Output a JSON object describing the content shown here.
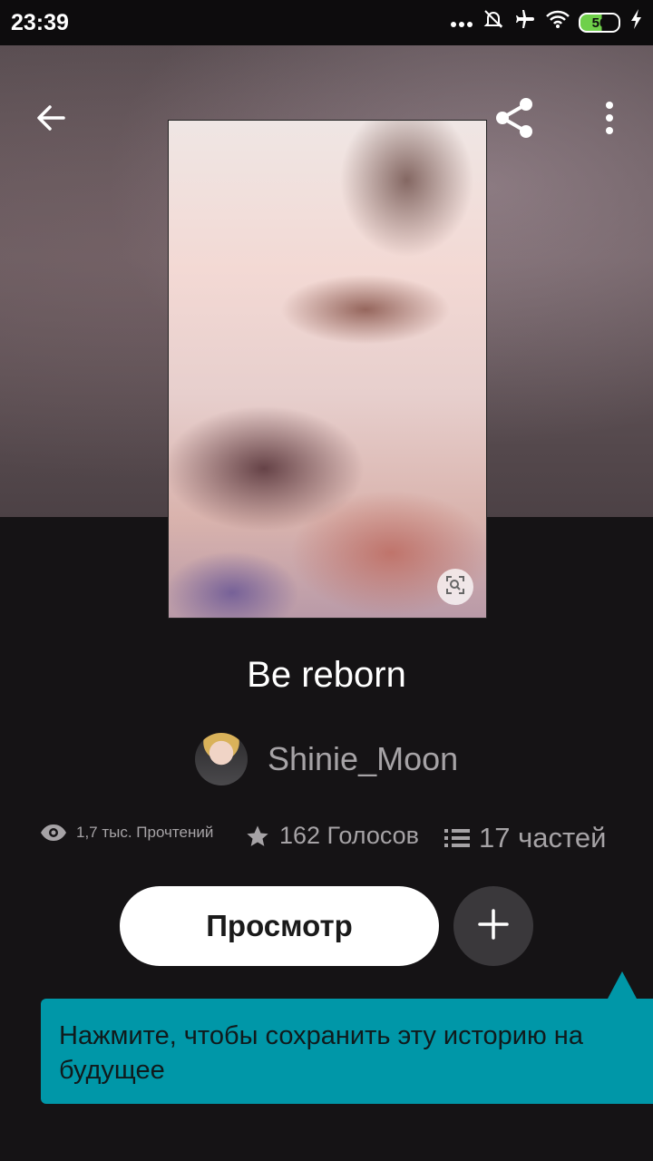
{
  "status_bar": {
    "time": "23:39",
    "battery": "56",
    "icons": [
      "more-dots-icon",
      "bell-muted-icon",
      "airplane-icon",
      "wifi-icon",
      "battery-icon",
      "charging-icon"
    ]
  },
  "header": {
    "icons": [
      "back-arrow-icon",
      "share-icon",
      "more-vert-icon"
    ]
  },
  "story": {
    "title": "Be reborn",
    "author": "Shinie_Moon",
    "reads": "1,7 тыс. Прочтений",
    "votes": "162 Голосов",
    "parts": "17 частей"
  },
  "actions": {
    "read_label": "Просмотр",
    "add_icon": "plus-icon"
  },
  "tooltip": {
    "text": "Нажмите, чтобы сохранить эту историю на будущее"
  },
  "colors": {
    "background": "#151315",
    "tooltip": "#0097a8",
    "muted_text": "#a6a3a6"
  }
}
